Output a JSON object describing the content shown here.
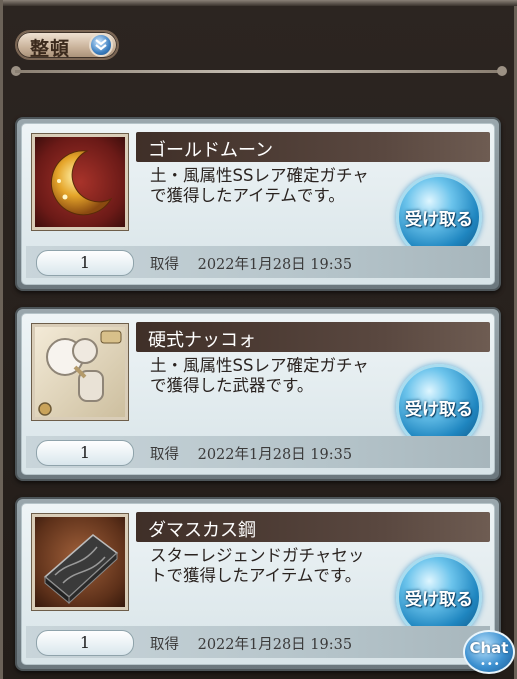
{
  "toolbar": {
    "sort_label": "整頓",
    "sort_icon": "double-chevron-down-icon"
  },
  "items": [
    {
      "name": "ゴールドムーン",
      "description": "土・風属性SSレア確定ガチャで獲得したアイテムです。",
      "quantity": "1",
      "obtained_label": "取得",
      "obtained_date": "2022年1月28日 19:35",
      "receive_label": "受け取る",
      "icon": "gold-moon-icon"
    },
    {
      "name": "硬式ナッコォ",
      "description": "土・風属性SSレア確定ガチャで獲得した武器です。",
      "quantity": "1",
      "obtained_label": "取得",
      "obtained_date": "2022年1月28日 19:35",
      "receive_label": "受け取る",
      "icon": "knuckle-weapon-icon"
    },
    {
      "name": "ダマスカス鋼",
      "description": "スターレジェンドガチャセットで獲得したアイテムです。",
      "quantity": "1",
      "obtained_label": "取得",
      "obtained_date": "2022年1月28日 19:35",
      "receive_label": "受け取る",
      "icon": "damascus-steel-icon"
    }
  ],
  "chat": {
    "label": "Chat",
    "dots": "•••"
  }
}
